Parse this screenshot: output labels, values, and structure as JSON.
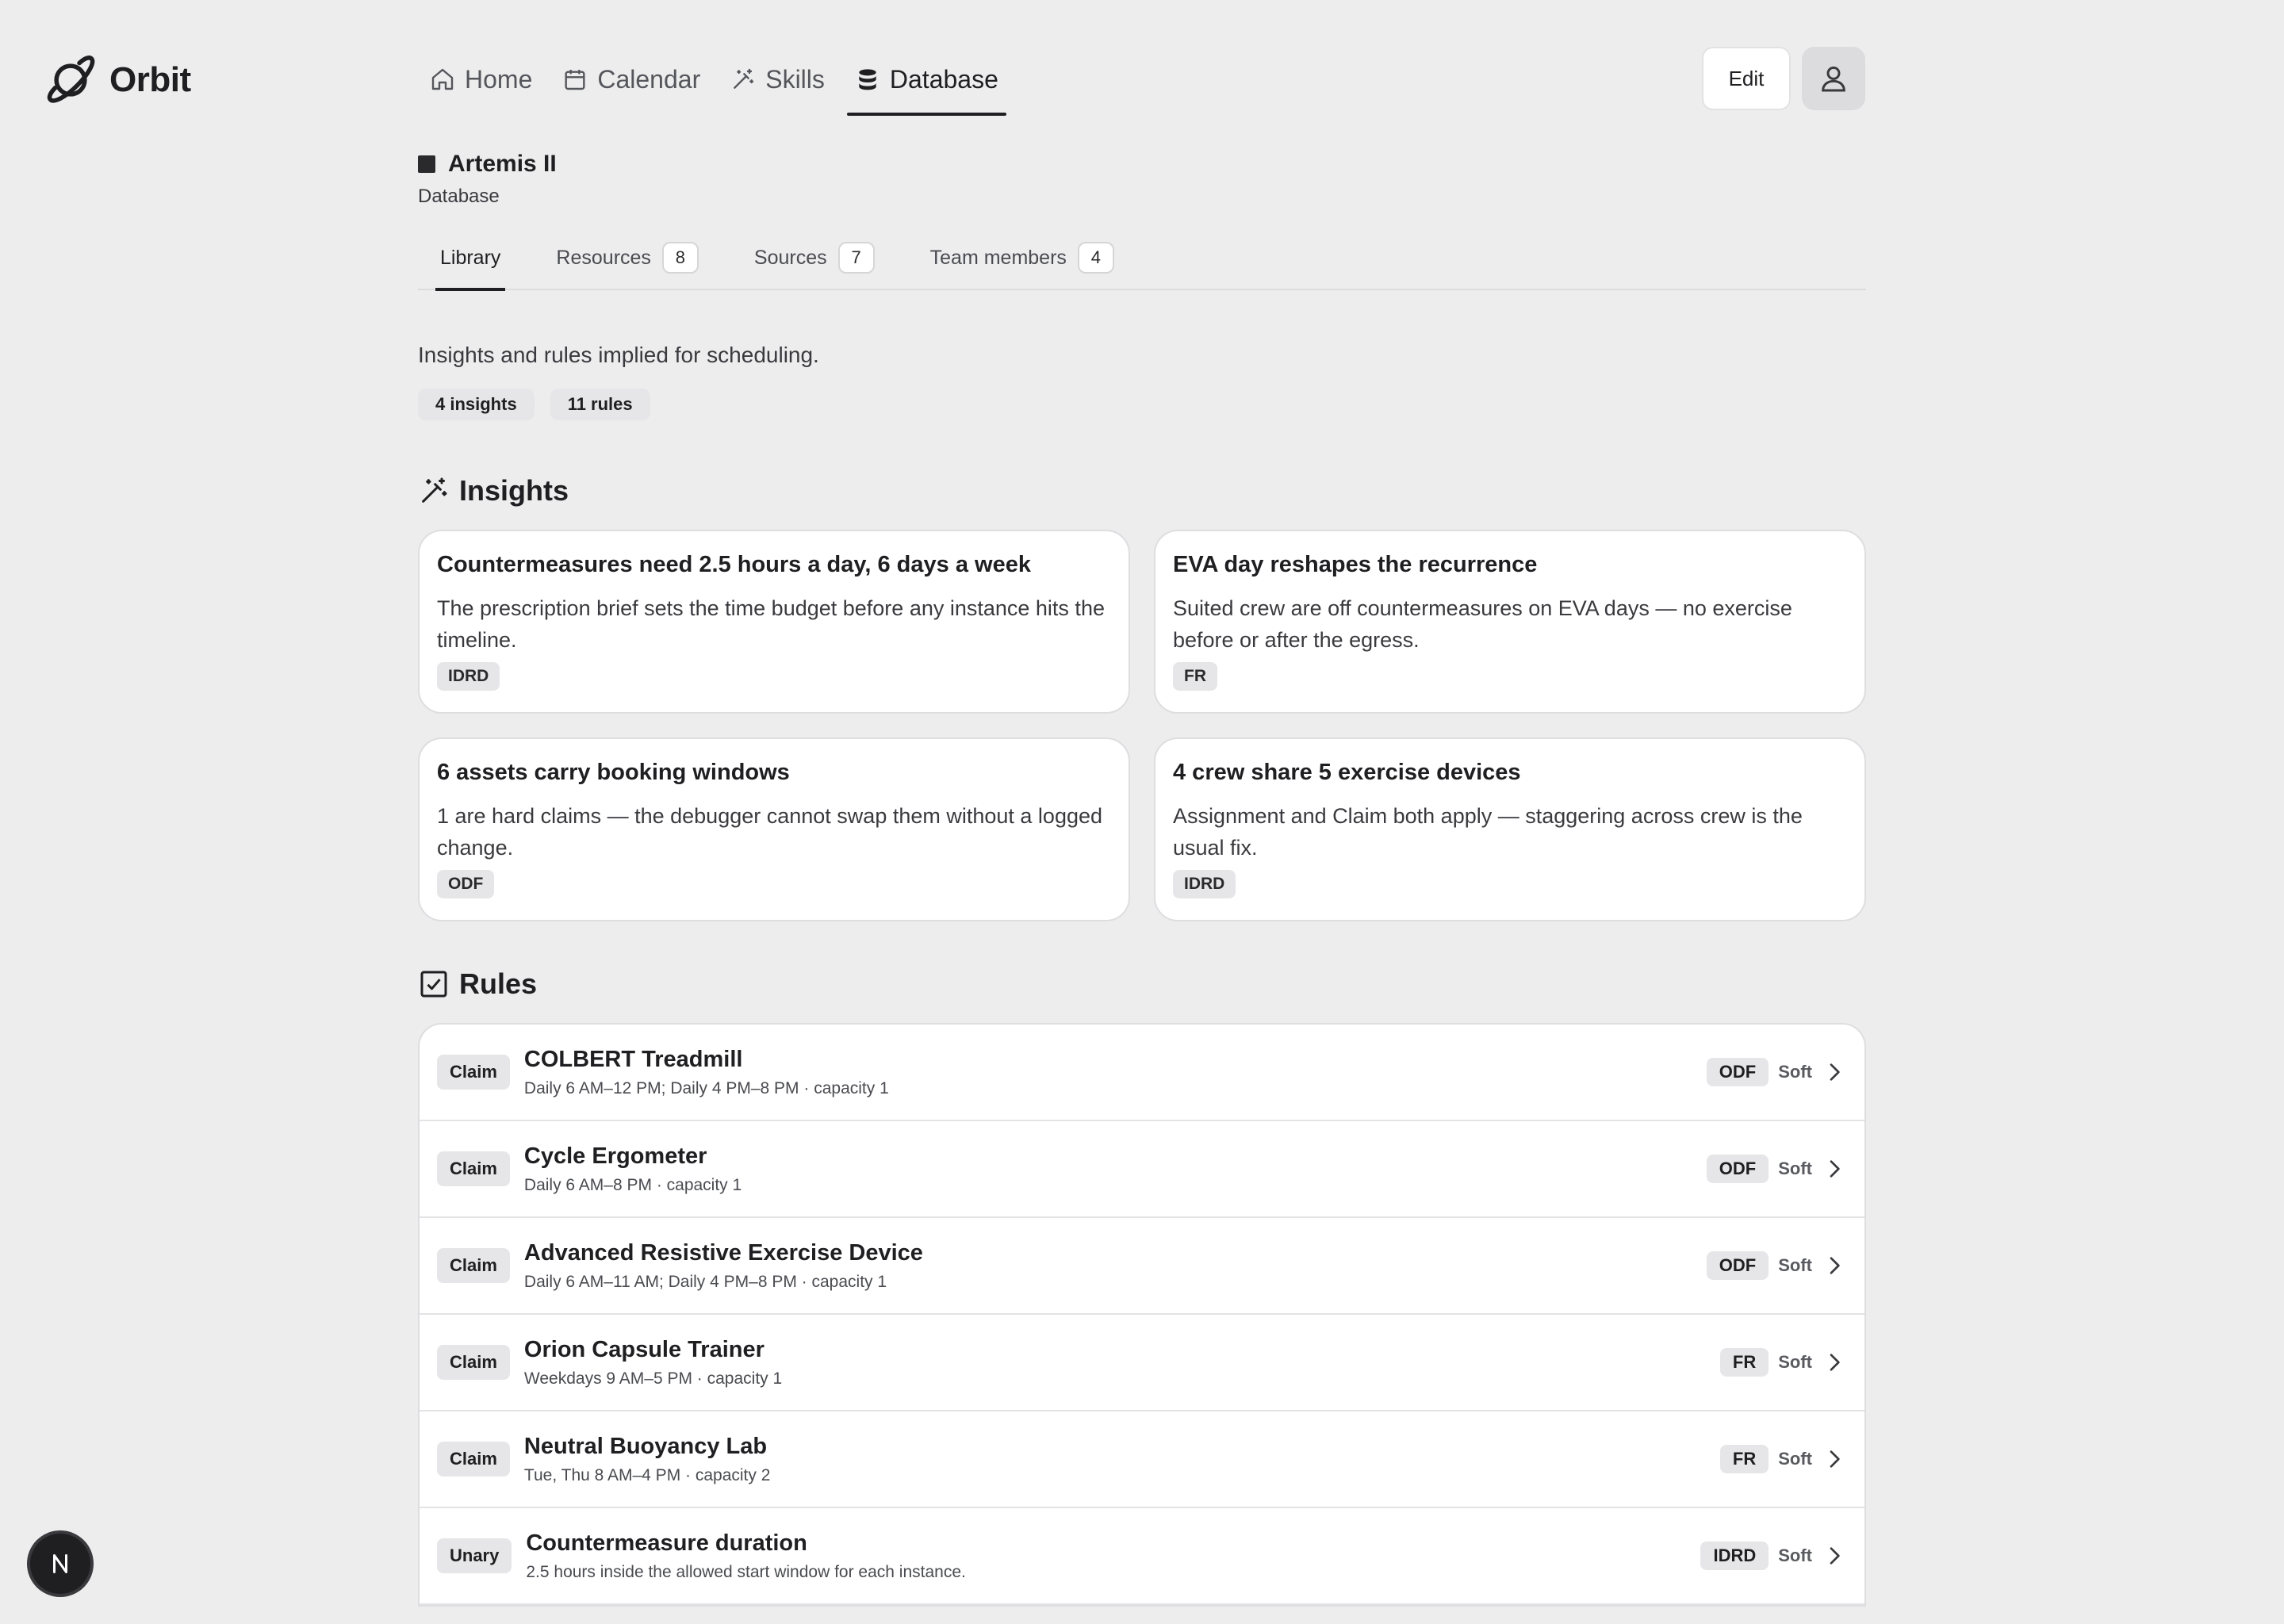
{
  "app": {
    "name": "Orbit"
  },
  "nav": [
    {
      "label": "Home",
      "icon": "home-icon",
      "active": false
    },
    {
      "label": "Calendar",
      "icon": "calendar-icon",
      "active": false
    },
    {
      "label": "Skills",
      "icon": "wand-icon",
      "active": false
    },
    {
      "label": "Database",
      "icon": "database-icon",
      "active": true
    }
  ],
  "header": {
    "edit_label": "Edit"
  },
  "project": {
    "name": "Artemis II",
    "section": "Database"
  },
  "tabs": [
    {
      "label": "Library",
      "count": null,
      "active": true
    },
    {
      "label": "Resources",
      "count": "8",
      "active": false
    },
    {
      "label": "Sources",
      "count": "7",
      "active": false
    },
    {
      "label": "Team members",
      "count": "4",
      "active": false
    }
  ],
  "library": {
    "intro": "Insights and rules implied for scheduling.",
    "stats": {
      "insights": "4 insights",
      "rules": "11 rules"
    }
  },
  "insights": {
    "heading": "Insights",
    "cards": [
      {
        "title": "Countermeasures need 2.5 hours a day, 6 days a week",
        "body": "The prescription brief sets the time budget before any instance hits the timeline.",
        "tag": "IDRD"
      },
      {
        "title": "EVA day reshapes the recurrence",
        "body": "Suited crew are off countermeasures on EVA days — no exercise before or after the egress.",
        "tag": "FR"
      },
      {
        "title": "6 assets carry booking windows",
        "body": "1 are hard claims — the debugger cannot swap them without a logged change.",
        "tag": "ODF"
      },
      {
        "title": "4 crew share 5 exercise devices",
        "body": "Assignment and Claim both apply — staggering across crew is the usual fix.",
        "tag": "IDRD"
      }
    ]
  },
  "rules": {
    "heading": "Rules",
    "items": [
      {
        "kind": "Claim",
        "title": "COLBERT Treadmill",
        "detail": "Daily 6 AM–12 PM; Daily 4 PM–8 PM · capacity 1",
        "source": "ODF",
        "strength": "Soft"
      },
      {
        "kind": "Claim",
        "title": "Cycle Ergometer",
        "detail": "Daily 6 AM–8 PM · capacity 1",
        "source": "ODF",
        "strength": "Soft"
      },
      {
        "kind": "Claim",
        "title": "Advanced Resistive Exercise Device",
        "detail": "Daily 6 AM–11 AM; Daily 4 PM–8 PM · capacity 1",
        "source": "ODF",
        "strength": "Soft"
      },
      {
        "kind": "Claim",
        "title": "Orion Capsule Trainer",
        "detail": "Weekdays 9 AM–5 PM · capacity 1",
        "source": "FR",
        "strength": "Soft"
      },
      {
        "kind": "Claim",
        "title": "Neutral Buoyancy Lab",
        "detail": "Tue, Thu 8 AM–4 PM · capacity 2",
        "source": "FR",
        "strength": "Soft"
      },
      {
        "kind": "Unary",
        "title": "Countermeasure duration",
        "detail": "2.5 hours inside the allowed start window for each instance.",
        "source": "IDRD",
        "strength": "Soft"
      }
    ]
  },
  "dev_badge": {
    "letter": "N"
  }
}
